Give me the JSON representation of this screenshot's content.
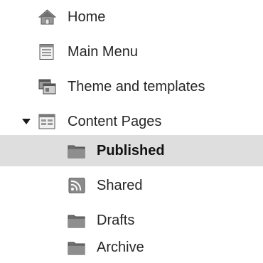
{
  "tree": {
    "items": [
      {
        "label": "Home",
        "icon": "home-icon"
      },
      {
        "label": "Main Menu",
        "icon": "menu-document-icon"
      },
      {
        "label": "Theme and templates",
        "icon": "theme-templates-icon"
      },
      {
        "label": "Content Pages",
        "icon": "content-pages-icon",
        "expanded": true
      },
      {
        "label": "Published",
        "icon": "folder-icon",
        "selected": true
      },
      {
        "label": "Shared",
        "icon": "rss-feed-icon"
      },
      {
        "label": "Drafts",
        "icon": "folder-icon"
      },
      {
        "label": "Archive",
        "icon": "folder-icon"
      }
    ]
  },
  "colors": {
    "selected_background": "#dedede",
    "text": "#262626",
    "icon_gray": "#8a8a8a"
  }
}
